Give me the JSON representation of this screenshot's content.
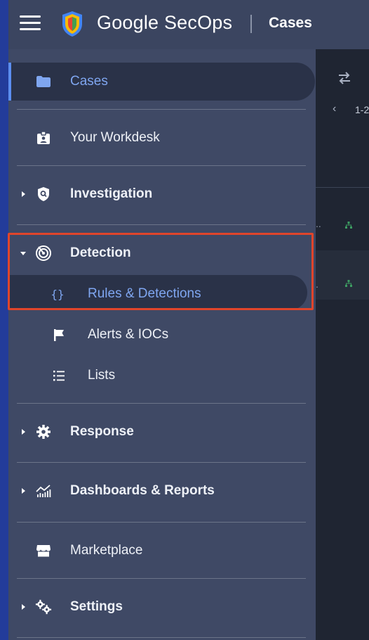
{
  "header": {
    "brand": "Google SecOps",
    "page_name": "Cases"
  },
  "sidebar": {
    "items": [
      {
        "label": "Cases",
        "icon": "folder-icon",
        "active": true
      },
      {
        "label": "Your Workdesk",
        "icon": "badge-icon"
      },
      {
        "label": "Investigation",
        "icon": "shield-search-icon",
        "expandable": true
      },
      {
        "label": "Detection",
        "icon": "radar-icon",
        "expandable": true,
        "expanded": true
      },
      {
        "label": "Rules & Detections",
        "icon": "braces-icon",
        "selected": true
      },
      {
        "label": "Alerts & IOCs",
        "icon": "flag-icon"
      },
      {
        "label": "Lists",
        "icon": "list-icon"
      },
      {
        "label": "Response",
        "icon": "gear-icon",
        "expandable": true
      },
      {
        "label": "Dashboards & Reports",
        "icon": "chart-icon",
        "expandable": true
      },
      {
        "label": "Marketplace",
        "icon": "store-icon"
      },
      {
        "label": "Settings",
        "icon": "gears-icon",
        "expandable": true
      }
    ]
  },
  "content": {
    "pager_text": "1-2"
  },
  "colors": {
    "accent": "#7fa6f0",
    "highlight": "#e0452b",
    "sidebar_bg": "#3f4965",
    "header_bg": "#3b4560"
  }
}
